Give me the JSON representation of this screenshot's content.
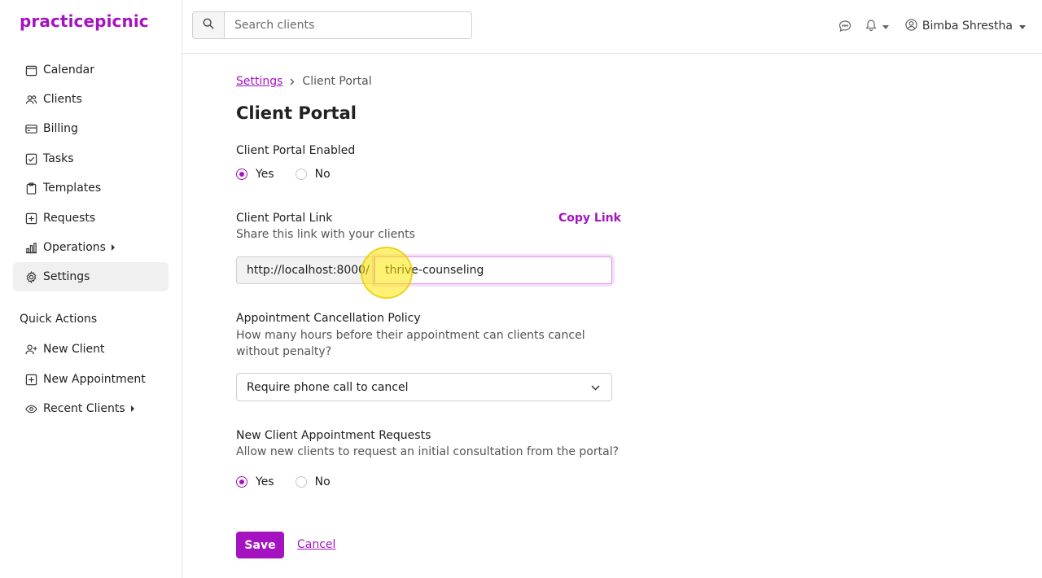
{
  "app": {
    "logo": "practicepicnic",
    "brand_color": "#a513c0"
  },
  "sidebar": {
    "items": [
      {
        "label": "Calendar",
        "icon": "calendar-icon"
      },
      {
        "label": "Clients",
        "icon": "users-icon"
      },
      {
        "label": "Billing",
        "icon": "credit-card-icon"
      },
      {
        "label": "Tasks",
        "icon": "checkbox-icon"
      },
      {
        "label": "Templates",
        "icon": "clipboard-icon"
      },
      {
        "label": "Requests",
        "icon": "plus-square-icon"
      },
      {
        "label": "Operations",
        "icon": "bar-chart-icon"
      },
      {
        "label": "Settings",
        "icon": "gear-icon",
        "active": true
      }
    ],
    "quick_actions_label": "Quick Actions",
    "quick_actions": [
      {
        "label": "New Client",
        "icon": "user-plus-icon"
      },
      {
        "label": "New Appointment",
        "icon": "calendar-plus-icon"
      },
      {
        "label": "Recent Clients",
        "icon": "eye-icon"
      }
    ]
  },
  "topbar": {
    "search_placeholder": "Search clients",
    "user_name": "Bimba Shrestha"
  },
  "main": {
    "breadcrumb": {
      "parent": "Settings",
      "current": "Client Portal"
    },
    "title": "Client Portal",
    "portal_enabled": {
      "label": "Client Portal Enabled",
      "yes": "Yes",
      "no": "No",
      "selected": "Yes"
    },
    "portal_link": {
      "label": "Client Portal Link",
      "help": "Share this link with your clients",
      "copy_label": "Copy Link",
      "prefix": "http://localhost:8000/",
      "slug": "thrive-counseling"
    },
    "cancellation": {
      "label": "Appointment Cancellation Policy",
      "help": "How many hours before their appointment can clients cancel without penalty?",
      "selected": "Require phone call to cancel"
    },
    "new_requests": {
      "label": "New Client Appointment Requests",
      "help": "Allow new clients to request an initial consultation from the portal?",
      "yes": "Yes",
      "no": "No",
      "selected": "Yes"
    },
    "save_label": "Save",
    "cancel_label": "Cancel"
  }
}
